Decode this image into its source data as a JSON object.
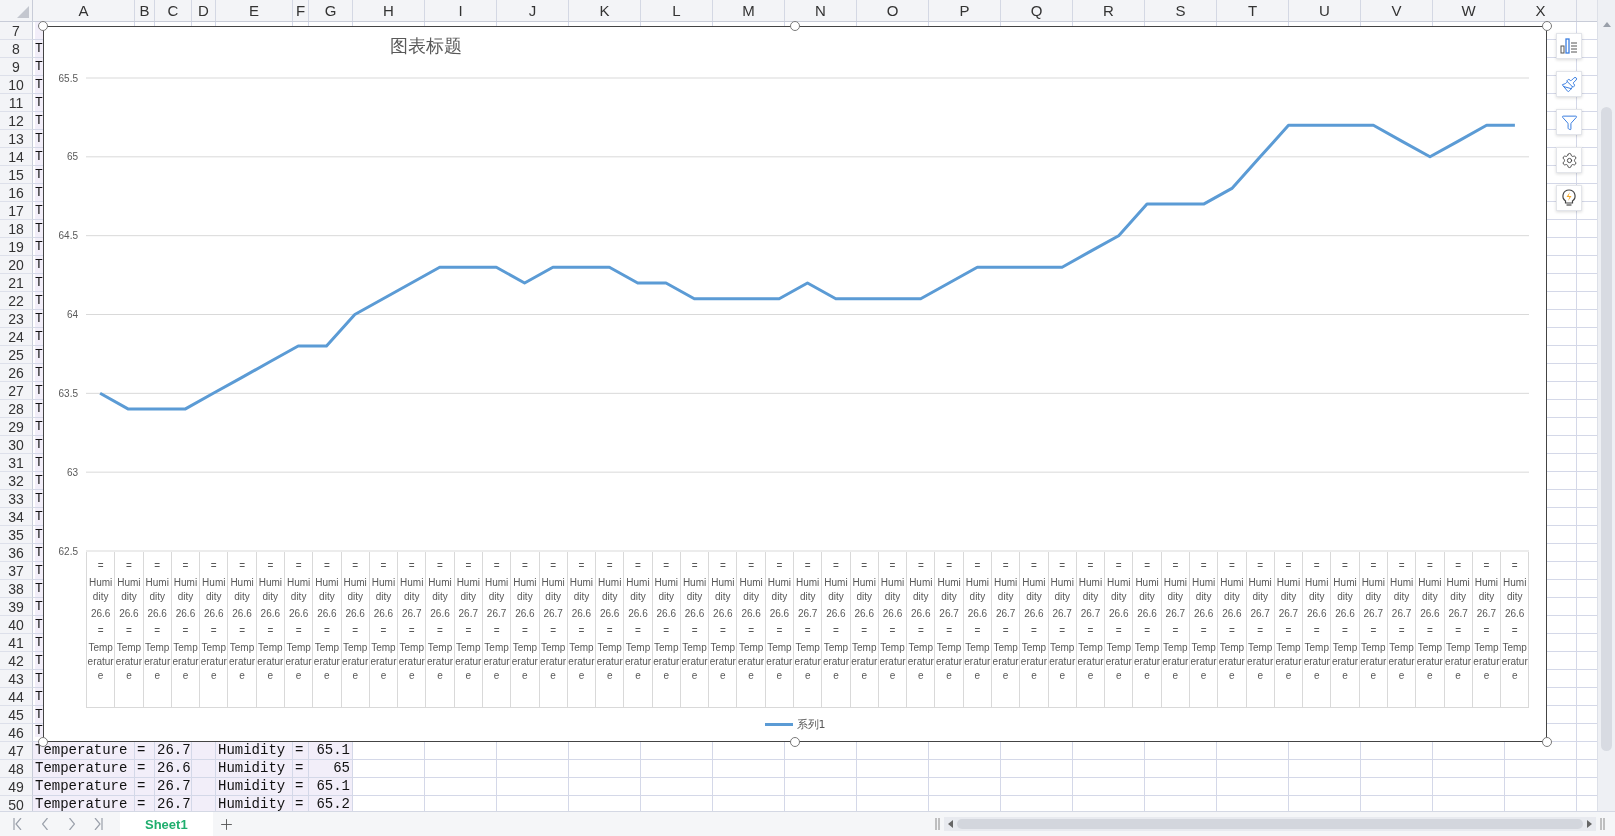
{
  "columns": [
    {
      "label": "A",
      "selected": true
    },
    {
      "label": "B",
      "selected": true
    },
    {
      "label": "C",
      "selected": true
    },
    {
      "label": "D",
      "selected": true
    },
    {
      "label": "E",
      "selected": true
    },
    {
      "label": "F",
      "selected": true
    },
    {
      "label": "G",
      "selected": true
    },
    {
      "label": "H",
      "selected": false
    },
    {
      "label": "I",
      "selected": false
    },
    {
      "label": "J",
      "selected": false
    },
    {
      "label": "K",
      "selected": false
    },
    {
      "label": "L",
      "selected": false
    },
    {
      "label": "M",
      "selected": false
    },
    {
      "label": "N",
      "selected": false
    },
    {
      "label": "O",
      "selected": false
    },
    {
      "label": "P",
      "selected": false
    },
    {
      "label": "Q",
      "selected": false
    },
    {
      "label": "R",
      "selected": false
    },
    {
      "label": "S",
      "selected": false
    },
    {
      "label": "T",
      "selected": false
    },
    {
      "label": "U",
      "selected": false
    },
    {
      "label": "V",
      "selected": false
    },
    {
      "label": "W",
      "selected": false
    },
    {
      "label": "X",
      "selected": false
    }
  ],
  "rows": [
    {
      "number": "7"
    },
    {
      "number": "8",
      "cells": {
        "A": "T"
      }
    },
    {
      "number": "9",
      "cells": {
        "A": "T"
      }
    },
    {
      "number": "10",
      "cells": {
        "A": "T"
      }
    },
    {
      "number": "11",
      "cells": {
        "A": "T"
      }
    },
    {
      "number": "12",
      "cells": {
        "A": "T"
      }
    },
    {
      "number": "13",
      "cells": {
        "A": "T"
      }
    },
    {
      "number": "14",
      "cells": {
        "A": "T"
      }
    },
    {
      "number": "15",
      "cells": {
        "A": "T"
      }
    },
    {
      "number": "16",
      "cells": {
        "A": "T"
      }
    },
    {
      "number": "17",
      "cells": {
        "A": "T"
      }
    },
    {
      "number": "18",
      "cells": {
        "A": "T"
      }
    },
    {
      "number": "19",
      "cells": {
        "A": "T"
      }
    },
    {
      "number": "20",
      "cells": {
        "A": "T"
      }
    },
    {
      "number": "21",
      "cells": {
        "A": "T"
      }
    },
    {
      "number": "22",
      "cells": {
        "A": "T"
      }
    },
    {
      "number": "23",
      "cells": {
        "A": "T"
      }
    },
    {
      "number": "24",
      "cells": {
        "A": "T"
      }
    },
    {
      "number": "25",
      "cells": {
        "A": "T"
      }
    },
    {
      "number": "26",
      "cells": {
        "A": "T"
      }
    },
    {
      "number": "27",
      "cells": {
        "A": "T"
      }
    },
    {
      "number": "28",
      "cells": {
        "A": "T"
      }
    },
    {
      "number": "29",
      "cells": {
        "A": "T"
      }
    },
    {
      "number": "30",
      "cells": {
        "A": "T"
      }
    },
    {
      "number": "31",
      "cells": {
        "A": "T"
      }
    },
    {
      "number": "32",
      "cells": {
        "A": "T"
      }
    },
    {
      "number": "33",
      "cells": {
        "A": "T"
      }
    },
    {
      "number": "34",
      "cells": {
        "A": "T"
      }
    },
    {
      "number": "35",
      "cells": {
        "A": "T"
      }
    },
    {
      "number": "36",
      "cells": {
        "A": "T"
      }
    },
    {
      "number": "37",
      "cells": {
        "A": "T"
      }
    },
    {
      "number": "38",
      "cells": {
        "A": "T"
      }
    },
    {
      "number": "39",
      "cells": {
        "A": "T"
      }
    },
    {
      "number": "40",
      "cells": {
        "A": "T"
      }
    },
    {
      "number": "41",
      "cells": {
        "A": "T"
      }
    },
    {
      "number": "42",
      "cells": {
        "A": "T"
      }
    },
    {
      "number": "43",
      "cells": {
        "A": "T"
      }
    },
    {
      "number": "44",
      "cells": {
        "A": "T"
      }
    },
    {
      "number": "45",
      "cells": {
        "A": "T"
      }
    },
    {
      "number": "46",
      "cells": {
        "A": "T"
      }
    },
    {
      "number": "47",
      "cells": {
        "A": "Temperature",
        "B": "=",
        "C": "26.7",
        "E": "Humidity",
        "F": "=",
        "G": "65.1"
      }
    },
    {
      "number": "48",
      "cells": {
        "A": "Temperature",
        "B": "=",
        "C": "26.6",
        "E": "Humidity",
        "F": "=",
        "G": "65"
      }
    },
    {
      "number": "49",
      "cells": {
        "A": "Temperature",
        "B": "=",
        "C": "26.7",
        "E": "Humidity",
        "F": "=",
        "G": "65.1"
      }
    },
    {
      "number": "50",
      "cells": {
        "A": "Temperature",
        "B": "=",
        "C": "26.7",
        "E": "Humidity",
        "F": "=",
        "G": "65.2"
      }
    }
  ],
  "chart": {
    "chart_data": {
      "type": "line",
      "title": "图表标题",
      "ylim": [
        62.5,
        65.5
      ],
      "grid": true,
      "yticks": [
        {
          "value": 62.5,
          "label": "62.5"
        },
        {
          "value": 63,
          "label": "63"
        },
        {
          "value": 63.5,
          "label": "63.5"
        },
        {
          "value": 64,
          "label": "64"
        },
        {
          "value": 64.5,
          "label": "64.5"
        },
        {
          "value": 65,
          "label": "65"
        },
        {
          "value": 65.5,
          "label": "65.5"
        }
      ],
      "categories": [
        "= Humidity 26.6 = Temperature",
        "= Humidity 26.6 = Temperature",
        "= Humidity 26.6 = Temperature",
        "= Humidity 26.6 = Temperature",
        "= Humidity 26.6 = Temperature",
        "= Humidity 26.6 = Temperature",
        "= Humidity 26.6 = Temperature",
        "= Humidity 26.6 = Temperature",
        "= Humidity 26.6 = Temperature",
        "= Humidity 26.6 = Temperature",
        "= Humidity 26.6 = Temperature",
        "= Humidity 26.7 = Temperature",
        "= Humidity 26.6 = Temperature",
        "= Humidity 26.7 = Temperature",
        "= Humidity 26.7 = Temperature",
        "= Humidity 26.6 = Temperature",
        "= Humidity 26.7 = Temperature",
        "= Humidity 26.6 = Temperature",
        "= Humidity 26.6 = Temperature",
        "= Humidity 26.6 = Temperature",
        "= Humidity 26.6 = Temperature",
        "= Humidity 26.6 = Temperature",
        "= Humidity 26.6 = Temperature",
        "= Humidity 26.6 = Temperature",
        "= Humidity 26.6 = Temperature",
        "= Humidity 26.7 = Temperature",
        "= Humidity 26.6 = Temperature",
        "= Humidity 26.6 = Temperature",
        "= Humidity 26.6 = Temperature",
        "= Humidity 26.6 = Temperature",
        "= Humidity 26.7 = Temperature",
        "= Humidity 26.6 = Temperature",
        "= Humidity 26.7 = Temperature",
        "= Humidity 26.6 = Temperature",
        "= Humidity 26.7 = Temperature",
        "= Humidity 26.7 = Temperature",
        "= Humidity 26.6 = Temperature",
        "= Humidity 26.6 = Temperature",
        "= Humidity 26.7 = Temperature",
        "= Humidity 26.6 = Temperature",
        "= Humidity 26.6 = Temperature",
        "= Humidity 26.7 = Temperature",
        "= Humidity 26.7 = Temperature",
        "= Humidity 26.6 = Temperature",
        "= Humidity 26.6 = Temperature",
        "= Humidity 26.7 = Temperature",
        "= Humidity 26.7 = Temperature",
        "= Humidity 26.6 = Temperature",
        "= Humidity 26.7 = Temperature",
        "= Humidity 26.7 = Temperature",
        "= Humidity 26.6 = Temperature"
      ],
      "series": [
        {
          "name": "系列1",
          "color": "#5b9bd5",
          "values": [
            63.5,
            63.4,
            63.4,
            63.4,
            63.5,
            63.6,
            63.7,
            63.8,
            63.8,
            64.0,
            64.1,
            64.2,
            64.3,
            64.3,
            64.3,
            64.2,
            64.3,
            64.3,
            64.3,
            64.2,
            64.2,
            64.1,
            64.1,
            64.1,
            64.1,
            64.2,
            64.1,
            64.1,
            64.1,
            64.1,
            64.2,
            64.3,
            64.3,
            64.3,
            64.3,
            64.4,
            64.5,
            64.7,
            64.7,
            64.7,
            64.8,
            65.0,
            65.2,
            65.2,
            65.2,
            65.2,
            65.1,
            65.0,
            65.1,
            65.2,
            65.2
          ]
        }
      ]
    }
  },
  "sheets": [
    {
      "label": "Sheet1",
      "selected": true
    }
  ]
}
